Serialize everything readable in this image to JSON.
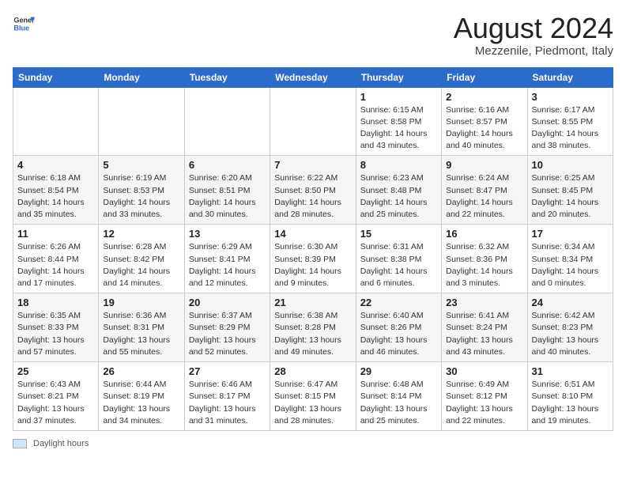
{
  "header": {
    "logo_general": "General",
    "logo_blue": "Blue",
    "title": "August 2024",
    "subtitle": "Mezzenile, Piedmont, Italy"
  },
  "calendar": {
    "days_of_week": [
      "Sunday",
      "Monday",
      "Tuesday",
      "Wednesday",
      "Thursday",
      "Friday",
      "Saturday"
    ],
    "weeks": [
      [
        {
          "num": "",
          "info": ""
        },
        {
          "num": "",
          "info": ""
        },
        {
          "num": "",
          "info": ""
        },
        {
          "num": "",
          "info": ""
        },
        {
          "num": "1",
          "info": "Sunrise: 6:15 AM\nSunset: 8:58 PM\nDaylight: 14 hours and 43 minutes."
        },
        {
          "num": "2",
          "info": "Sunrise: 6:16 AM\nSunset: 8:57 PM\nDaylight: 14 hours and 40 minutes."
        },
        {
          "num": "3",
          "info": "Sunrise: 6:17 AM\nSunset: 8:55 PM\nDaylight: 14 hours and 38 minutes."
        }
      ],
      [
        {
          "num": "4",
          "info": "Sunrise: 6:18 AM\nSunset: 8:54 PM\nDaylight: 14 hours and 35 minutes."
        },
        {
          "num": "5",
          "info": "Sunrise: 6:19 AM\nSunset: 8:53 PM\nDaylight: 14 hours and 33 minutes."
        },
        {
          "num": "6",
          "info": "Sunrise: 6:20 AM\nSunset: 8:51 PM\nDaylight: 14 hours and 30 minutes."
        },
        {
          "num": "7",
          "info": "Sunrise: 6:22 AM\nSunset: 8:50 PM\nDaylight: 14 hours and 28 minutes."
        },
        {
          "num": "8",
          "info": "Sunrise: 6:23 AM\nSunset: 8:48 PM\nDaylight: 14 hours and 25 minutes."
        },
        {
          "num": "9",
          "info": "Sunrise: 6:24 AM\nSunset: 8:47 PM\nDaylight: 14 hours and 22 minutes."
        },
        {
          "num": "10",
          "info": "Sunrise: 6:25 AM\nSunset: 8:45 PM\nDaylight: 14 hours and 20 minutes."
        }
      ],
      [
        {
          "num": "11",
          "info": "Sunrise: 6:26 AM\nSunset: 8:44 PM\nDaylight: 14 hours and 17 minutes."
        },
        {
          "num": "12",
          "info": "Sunrise: 6:28 AM\nSunset: 8:42 PM\nDaylight: 14 hours and 14 minutes."
        },
        {
          "num": "13",
          "info": "Sunrise: 6:29 AM\nSunset: 8:41 PM\nDaylight: 14 hours and 12 minutes."
        },
        {
          "num": "14",
          "info": "Sunrise: 6:30 AM\nSunset: 8:39 PM\nDaylight: 14 hours and 9 minutes."
        },
        {
          "num": "15",
          "info": "Sunrise: 6:31 AM\nSunset: 8:38 PM\nDaylight: 14 hours and 6 minutes."
        },
        {
          "num": "16",
          "info": "Sunrise: 6:32 AM\nSunset: 8:36 PM\nDaylight: 14 hours and 3 minutes."
        },
        {
          "num": "17",
          "info": "Sunrise: 6:34 AM\nSunset: 8:34 PM\nDaylight: 14 hours and 0 minutes."
        }
      ],
      [
        {
          "num": "18",
          "info": "Sunrise: 6:35 AM\nSunset: 8:33 PM\nDaylight: 13 hours and 57 minutes."
        },
        {
          "num": "19",
          "info": "Sunrise: 6:36 AM\nSunset: 8:31 PM\nDaylight: 13 hours and 55 minutes."
        },
        {
          "num": "20",
          "info": "Sunrise: 6:37 AM\nSunset: 8:29 PM\nDaylight: 13 hours and 52 minutes."
        },
        {
          "num": "21",
          "info": "Sunrise: 6:38 AM\nSunset: 8:28 PM\nDaylight: 13 hours and 49 minutes."
        },
        {
          "num": "22",
          "info": "Sunrise: 6:40 AM\nSunset: 8:26 PM\nDaylight: 13 hours and 46 minutes."
        },
        {
          "num": "23",
          "info": "Sunrise: 6:41 AM\nSunset: 8:24 PM\nDaylight: 13 hours and 43 minutes."
        },
        {
          "num": "24",
          "info": "Sunrise: 6:42 AM\nSunset: 8:23 PM\nDaylight: 13 hours and 40 minutes."
        }
      ],
      [
        {
          "num": "25",
          "info": "Sunrise: 6:43 AM\nSunset: 8:21 PM\nDaylight: 13 hours and 37 minutes."
        },
        {
          "num": "26",
          "info": "Sunrise: 6:44 AM\nSunset: 8:19 PM\nDaylight: 13 hours and 34 minutes."
        },
        {
          "num": "27",
          "info": "Sunrise: 6:46 AM\nSunset: 8:17 PM\nDaylight: 13 hours and 31 minutes."
        },
        {
          "num": "28",
          "info": "Sunrise: 6:47 AM\nSunset: 8:15 PM\nDaylight: 13 hours and 28 minutes."
        },
        {
          "num": "29",
          "info": "Sunrise: 6:48 AM\nSunset: 8:14 PM\nDaylight: 13 hours and 25 minutes."
        },
        {
          "num": "30",
          "info": "Sunrise: 6:49 AM\nSunset: 8:12 PM\nDaylight: 13 hours and 22 minutes."
        },
        {
          "num": "31",
          "info": "Sunrise: 6:51 AM\nSunset: 8:10 PM\nDaylight: 13 hours and 19 minutes."
        }
      ]
    ]
  },
  "footer": {
    "label": "Daylight hours"
  }
}
